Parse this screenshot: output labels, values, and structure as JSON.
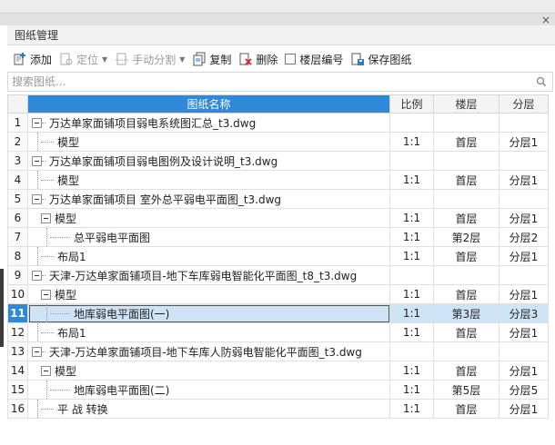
{
  "window": {
    "close_glyph": "×"
  },
  "panel": {
    "title": "图纸管理"
  },
  "toolbar": {
    "add": "添加",
    "locate": "定位",
    "split": "手动分割",
    "copy": "复制",
    "delete": "删除",
    "floor_number": "楼层编号",
    "save": "保存图纸"
  },
  "search": {
    "placeholder": "搜索图纸..."
  },
  "table": {
    "headers": {
      "name": "图纸名称",
      "scale": "比例",
      "floor": "楼层",
      "layer": "分层"
    },
    "rows": [
      {
        "num": "1",
        "level": 0,
        "toggle": true,
        "name": "万达单家面铺项目弱电系统图汇总_t3.dwg",
        "scale": "",
        "floor": "",
        "layer": ""
      },
      {
        "num": "2",
        "level": 1,
        "toggle": false,
        "name": "模型",
        "scale": "1:1",
        "floor": "首层",
        "layer": "分层1"
      },
      {
        "num": "3",
        "level": 0,
        "toggle": true,
        "name": "万达单家面铺项目弱电图例及设计说明_t3.dwg",
        "scale": "",
        "floor": "",
        "layer": ""
      },
      {
        "num": "4",
        "level": 1,
        "toggle": false,
        "name": "模型",
        "scale": "1:1",
        "floor": "首层",
        "layer": "分层1"
      },
      {
        "num": "5",
        "level": 0,
        "toggle": true,
        "name": "万达单家面铺项目 室外总平弱电平面图_t3.dwg",
        "scale": "",
        "floor": "",
        "layer": ""
      },
      {
        "num": "6",
        "level": 1,
        "toggle": true,
        "name": "模型",
        "scale": "1:1",
        "floor": "首层",
        "layer": "分层1"
      },
      {
        "num": "7",
        "level": 2,
        "toggle": false,
        "name": "总平弱电平面图",
        "scale": "1:1",
        "floor": "第2层",
        "layer": "分层2"
      },
      {
        "num": "8",
        "level": 1,
        "toggle": false,
        "name": "布局1",
        "scale": "1:1",
        "floor": "首层",
        "layer": "分层1"
      },
      {
        "num": "9",
        "level": 0,
        "toggle": true,
        "name": "天津-万达单家面铺项目-地下车库弱电智能化平面图_t8_t3.dwg",
        "scale": "",
        "floor": "",
        "layer": ""
      },
      {
        "num": "10",
        "level": 1,
        "toggle": true,
        "name": "模型",
        "scale": "1:1",
        "floor": "首层",
        "layer": "分层1"
      },
      {
        "num": "11",
        "level": 2,
        "toggle": false,
        "name": "地库弱电平面图(一)",
        "scale": "1:1",
        "floor": "第3层",
        "layer": "分层3",
        "selected": true
      },
      {
        "num": "12",
        "level": 1,
        "toggle": false,
        "name": "布局1",
        "scale": "1:1",
        "floor": "首层",
        "layer": "分层1"
      },
      {
        "num": "13",
        "level": 0,
        "toggle": true,
        "name": "天津-万达单家面铺项目-地下车库人防弱电智能化平面图_t3.dwg",
        "scale": "",
        "floor": "",
        "layer": ""
      },
      {
        "num": "14",
        "level": 1,
        "toggle": true,
        "name": "模型",
        "scale": "1:1",
        "floor": "首层",
        "layer": "分层1"
      },
      {
        "num": "15",
        "level": 2,
        "toggle": false,
        "name": "地库弱电平面图(二)",
        "scale": "1:1",
        "floor": "第5层",
        "layer": "分层5"
      },
      {
        "num": "16",
        "level": 1,
        "toggle": false,
        "name": "平 战 转换",
        "scale": "1:1",
        "floor": "首层",
        "layer": "分层1"
      }
    ]
  },
  "colors": {
    "accent": "#2f88d8",
    "selected_row": "#cfe3f7"
  }
}
